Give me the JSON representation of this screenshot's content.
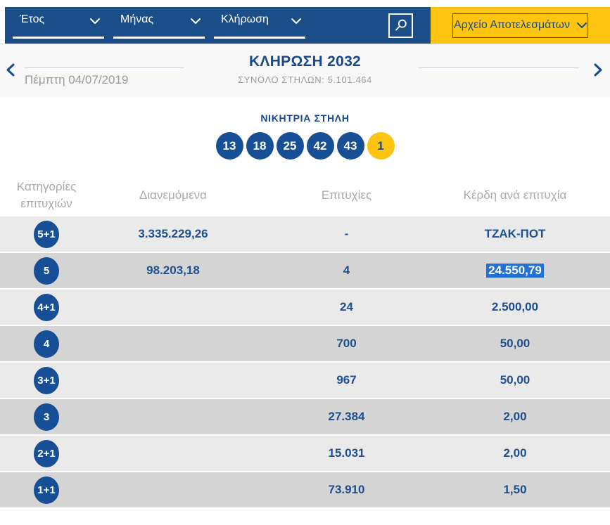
{
  "filters": {
    "year_label": "Έτος",
    "month_label": "Μήνας",
    "draw_label": "Κλήρωση",
    "archive_button_label": "Αρχείο Αποτελεσμάτων"
  },
  "nav": {
    "date": "Πέμπτη 04/07/2019",
    "title": "ΚΛΗΡΩΣΗ 2032",
    "columns_label": "ΣΥΝΟΛΟ ΣΤΗΛΩΝ:",
    "columns_value": "5.101.464"
  },
  "winning": {
    "heading": "ΝΙΚΗΤΡΙΑ ΣΤΗΛΗ",
    "numbers": [
      {
        "value": "13",
        "type": "main"
      },
      {
        "value": "18",
        "type": "main"
      },
      {
        "value": "25",
        "type": "main"
      },
      {
        "value": "42",
        "type": "main"
      },
      {
        "value": "43",
        "type": "main"
      },
      {
        "value": "1",
        "type": "bonus"
      }
    ]
  },
  "table": {
    "headers": [
      "Κατηγορίες επιτυχιών",
      "Διανεμόμενα",
      "Επιτυχίες",
      "Κέρδη ανά επιτυχία"
    ],
    "rows": [
      {
        "category": "5+1",
        "distributed": "3.335.229,26",
        "winners": "-",
        "prize": "ΤΖΑΚ-ΠΟΤ",
        "prize_selected": false
      },
      {
        "category": "5",
        "distributed": "98.203,18",
        "winners": "4",
        "prize": "24.550,79",
        "prize_selected": true
      },
      {
        "category": "4+1",
        "distributed": "",
        "winners": "24",
        "prize": "2.500,00",
        "prize_selected": false
      },
      {
        "category": "4",
        "distributed": "",
        "winners": "700",
        "prize": "50,00",
        "prize_selected": false
      },
      {
        "category": "3+1",
        "distributed": "",
        "winners": "967",
        "prize": "50,00",
        "prize_selected": false
      },
      {
        "category": "3",
        "distributed": "",
        "winners": "27.384",
        "prize": "2,00",
        "prize_selected": false
      },
      {
        "category": "2+1",
        "distributed": "",
        "winners": "15.031",
        "prize": "2,00",
        "prize_selected": false
      },
      {
        "category": "1+1",
        "distributed": "",
        "winners": "73.910",
        "prize": "1,50",
        "prize_selected": false
      }
    ]
  },
  "icons": {
    "search": "magnifier",
    "dropdown_arrow": "chevron-down",
    "prev": "chevron-left",
    "next": "chevron-right"
  },
  "colors": {
    "brand_blue": "#1b4d88",
    "text_blue": "#1d4f8f",
    "accent_yellow": "#fdc411",
    "number_ball_blue": "#164f95",
    "bonus_ball_yellow": "#fdc411",
    "selection_highlight": "#2171d8",
    "row_light": "#eaeaea",
    "row_dark": "#d5d5d5"
  }
}
